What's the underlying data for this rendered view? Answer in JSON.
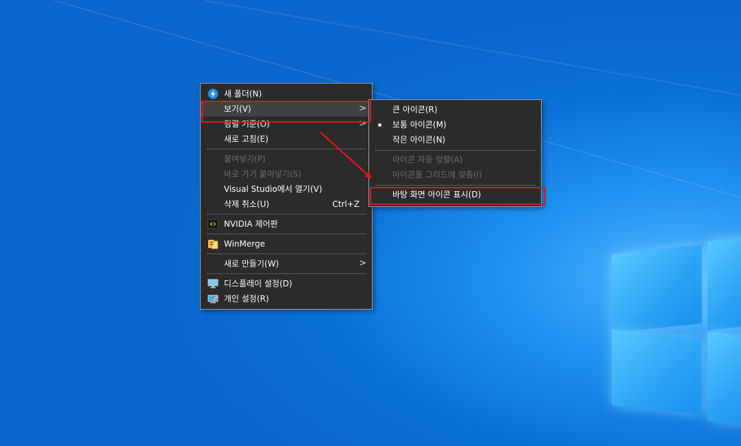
{
  "context_menu": {
    "items": [
      {
        "label": "새 폴더(N)",
        "icon": "new-folder-bolt-icon"
      },
      {
        "label": "보기(V)",
        "submenu": true
      },
      {
        "label": "정렬 기준(O)",
        "submenu": true
      },
      {
        "label": "새로 고침(E)"
      },
      {
        "label": "붙여넣기(P)",
        "disabled": true
      },
      {
        "label": "바로 가기 붙여넣기(S)",
        "disabled": true
      },
      {
        "label": "Visual Studio에서 열기(V)"
      },
      {
        "label": "삭제 취소(U)",
        "accelerator": "Ctrl+Z"
      },
      {
        "label": "NVIDIA 제어판",
        "icon": "nvidia-icon"
      },
      {
        "label": "WinMerge",
        "icon": "winmerge-icon"
      },
      {
        "label": "새로 만들기(W)",
        "submenu": true
      },
      {
        "label": "디스플레이 설정(D)",
        "icon": "display-settings-icon"
      },
      {
        "label": "개인 설정(R)",
        "icon": "personalize-icon"
      }
    ],
    "submenu_arrow": ">"
  },
  "view_submenu": {
    "items": [
      {
        "label": "큰 아이콘(R)"
      },
      {
        "label": "보통 아이콘(M)",
        "checked": true
      },
      {
        "label": "작은 아이콘(N)"
      },
      {
        "label": "아이콘 자동 정렬(A)",
        "disabled": true
      },
      {
        "label": "아이콘을 그리드에 맞춤(I)",
        "disabled": true
      },
      {
        "label": "바탕 화면 아이콘 표시(D)"
      }
    ]
  },
  "colors": {
    "menu_bg": "#2b2b2b",
    "hover_bg": "#414141",
    "annotation_red": "#e0161f",
    "desktop_blue": "#0a70d6"
  }
}
